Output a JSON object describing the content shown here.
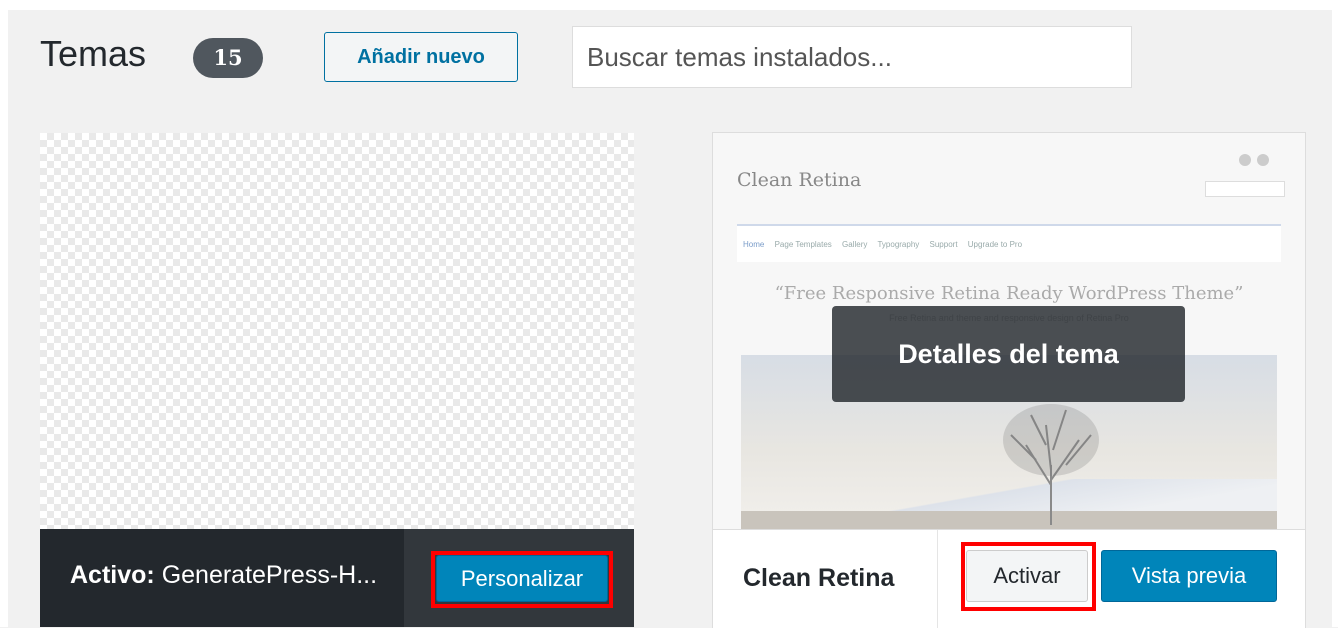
{
  "header": {
    "title": "Temas",
    "count": "15",
    "add_new_label": "Añadir nuevo",
    "search_placeholder": "Buscar temas instalados..."
  },
  "themes": [
    {
      "active_prefix": "Activo:",
      "name": "GeneratePress-H...",
      "customize_label": "Personalizar",
      "is_active": true
    },
    {
      "name": "Clean Retina",
      "overlay_label": "Detalles del tema",
      "activate_label": "Activar",
      "preview_label": "Vista previa",
      "screenshot": {
        "logo": "Clean Retina",
        "nav": [
          "Home",
          "Page Templates",
          "Gallery",
          "Typography",
          "Support",
          "Upgrade to Pro"
        ],
        "tagline": "“Free Responsive Retina Ready WordPress Theme”",
        "subline": "Free Retina and theme and responsive design of Retina Pro"
      }
    }
  ],
  "colors": {
    "primary_button": "#0085ba",
    "highlight": "#ff0000",
    "active_bar": "#23282d"
  }
}
